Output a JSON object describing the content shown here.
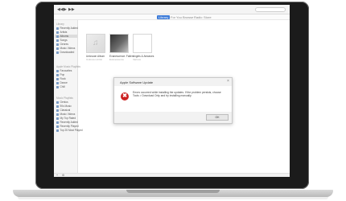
{
  "toolbar": {
    "controls": [
      "◀◀",
      "▶",
      "▶▶"
    ],
    "apple_logo_icon": "apple-logo-icon",
    "search_icon": "search-icon"
  },
  "tabs": [
    "Library",
    "For You",
    "Browse",
    "Radio",
    "Store"
  ],
  "sidebar": {
    "library_header": "Library",
    "library_items": [
      "Recently Added",
      "Artists",
      "Albums",
      "Songs",
      "Genres",
      "Music Videos",
      "Downloaded"
    ],
    "playlists_header": "Apple Music Playlists",
    "playlists_items": [
      "Favourites",
      "Pop",
      "Rock",
      "Dance",
      "Chill"
    ],
    "music_header": "Music Playlists",
    "music_items": [
      "Genius",
      "90s Music",
      "Classical",
      "Music Videos",
      "My Top Rated",
      "Recently Added",
      "Recently Played",
      "Top 25 Most Played"
    ]
  },
  "albums": [
    {
      "title": "Unknown Album",
      "subtitle": "Unknown Artist"
    },
    {
      "title": "Evanescence: Fallen",
      "subtitle": "Evanescence"
    },
    {
      "title": "Angels & Airwaves",
      "subtitle": "Various"
    }
  ],
  "footer": {
    "add_icon": "+",
    "settings_icon": "⚙"
  },
  "dialog": {
    "title": "Apple Software Update",
    "close_icon": "×",
    "error_icon": "✖",
    "message": "Errors occurred while installing the updates. If the problem persists, choose Tools > Download Only and try installing manually.",
    "ok_label": "OK"
  },
  "colors": {
    "accent": "#3d7bd8",
    "error": "#cc2020",
    "bezel": "#1b1b1b"
  }
}
